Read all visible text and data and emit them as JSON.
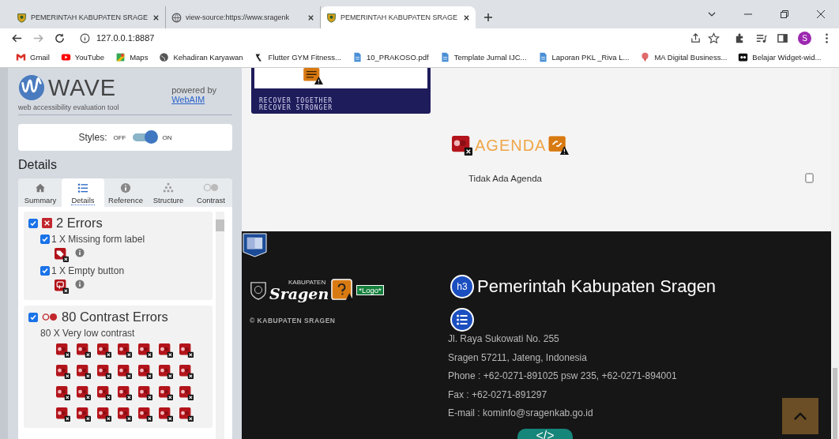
{
  "browser": {
    "tabs": [
      {
        "title": "PEMERINTAH KABUPATEN SRAGE",
        "kind": "crest",
        "selected": false
      },
      {
        "title": "view-source:https://www.sragenk",
        "kind": "globe",
        "selected": false
      },
      {
        "title": "PEMERINTAH KABUPATEN SRAGE",
        "kind": "crest",
        "selected": true
      }
    ],
    "url": "127.0.0.1:8887",
    "profile_initial": "S",
    "bookmarks": [
      {
        "label": "Gmail",
        "kind": "mail"
      },
      {
        "label": "YouTube",
        "kind": "video"
      },
      {
        "label": "Maps",
        "kind": "map"
      },
      {
        "label": "Kehadiran Karyawan",
        "kind": "globe"
      },
      {
        "label": "Flutter GYM Fitness...",
        "kind": "app"
      },
      {
        "label": "10_PRAKOSO.pdf",
        "kind": "doc"
      },
      {
        "label": "Template Jurnal IJC...",
        "kind": "doc"
      },
      {
        "label": "Laporan PKL _Riva L...",
        "kind": "doc"
      },
      {
        "label": "MA Digital Business...",
        "kind": "pin"
      },
      {
        "label": "Belajar Widget-wid...",
        "kind": "media"
      }
    ]
  },
  "wave": {
    "name": "WAVE",
    "tagline": "web accessibility evaluation tool",
    "powered_by": "powered by",
    "link": "WebAIM",
    "styles": {
      "label": "Styles:",
      "off": "OFF",
      "on_label": "ON",
      "on": true
    },
    "heading": "Details",
    "tabs": [
      {
        "label": "Summary",
        "kind": "home",
        "selected": false
      },
      {
        "label": "Details",
        "kind": "list",
        "selected": true
      },
      {
        "label": "Reference",
        "kind": "info",
        "selected": false
      },
      {
        "label": "Structure",
        "kind": "tree",
        "selected": false
      },
      {
        "label": "Contrast",
        "kind": "contrast",
        "selected": false
      }
    ],
    "groups": [
      {
        "title": "2 Errors",
        "kind": "error",
        "checked": true,
        "items": [
          {
            "label": "1 X Missing form label",
            "kind": "tag",
            "checked": true
          },
          {
            "label": "1 X Empty button",
            "kind": "button",
            "checked": true
          }
        ]
      },
      {
        "title": "80 Contrast Errors",
        "kind": "contrast",
        "checked": true,
        "items": [
          {
            "label": "80 X Very low contrast",
            "kind": "contrast"
          }
        ]
      }
    ]
  },
  "page": {
    "banner": [
      "RECOVER TOGETHER",
      "RECOVER STRONGER"
    ],
    "agenda": {
      "title": "AGENDA",
      "empty": "Tidak Ada Agenda"
    },
    "footer": {
      "logo_top": "KABUPATEN",
      "logo": "Sragen",
      "alt": "*Logo*",
      "copyright": "© KABUPATEN SRAGEN",
      "heading_tag": "h3",
      "heading": "Pemerintah Kabupaten Sragen",
      "lines": [
        "Jl. Raya Sukowati No. 255",
        "Sragen 57211, Jateng, Indonesia",
        "Phone : +62-0271-891025 psw 235, +62-0271-894001",
        "Fax : +62-0271-891297",
        "E-mail : kominfo@sragenkab.go.id"
      ],
      "code_button": "</>"
    }
  }
}
